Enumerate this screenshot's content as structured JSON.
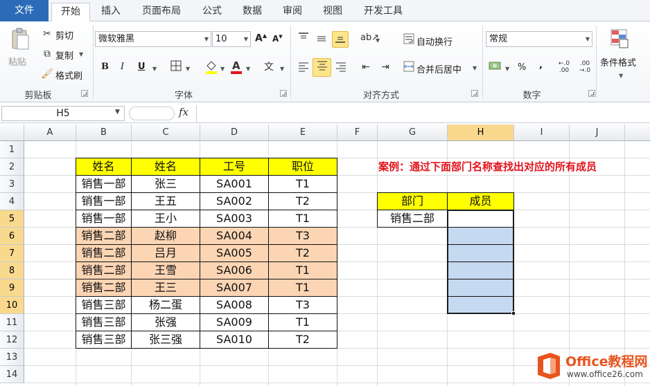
{
  "tabs": [
    "文件",
    "开始",
    "插入",
    "页面布局",
    "公式",
    "数据",
    "审阅",
    "视图",
    "开发工具"
  ],
  "ribbon": {
    "clipboard": {
      "paste": "粘贴",
      "cut": "剪切",
      "copy": "复制",
      "format_painter": "格式刷",
      "label": "剪贴板"
    },
    "font": {
      "name": "微软雅黑",
      "size": "10",
      "label": "字体"
    },
    "alignment": {
      "wrap_text": "自动换行",
      "merge_center": "合并后居中",
      "label": "对齐方式"
    },
    "number": {
      "format": "常规",
      "percent": "%",
      "comma": ",",
      "label": "数字"
    },
    "styles": {
      "conditional_format": "条件格式"
    }
  },
  "formula_bar": {
    "name_box": "H5",
    "fx": "fx",
    "content": ""
  },
  "grid": {
    "columns": [
      "A",
      "B",
      "C",
      "D",
      "E",
      "F",
      "G",
      "H",
      "I",
      "J"
    ],
    "rows": [
      "1",
      "2",
      "3",
      "4",
      "5",
      "6",
      "7",
      "8",
      "9",
      "10",
      "11",
      "12",
      "13",
      "14"
    ],
    "active_column": "H",
    "active_rows": [
      "5",
      "6",
      "7",
      "8",
      "9",
      "10"
    ]
  },
  "table": {
    "headers": [
      "姓名",
      "姓名",
      "工号",
      "职位"
    ],
    "rows": [
      [
        "销售一部",
        "张三",
        "SA001",
        "T1"
      ],
      [
        "销售一部",
        "王五",
        "SA002",
        "T2"
      ],
      [
        "销售一部",
        "王小",
        "SA003",
        "T1"
      ],
      [
        "销售二部",
        "赵柳",
        "SA004",
        "T3"
      ],
      [
        "销售二部",
        "吕月",
        "SA005",
        "T2"
      ],
      [
        "销售二部",
        "王雪",
        "SA006",
        "T1"
      ],
      [
        "销售二部",
        "王三",
        "SA007",
        "T1"
      ],
      [
        "销售三部",
        "杨二蛋",
        "SA008",
        "T3"
      ],
      [
        "销售三部",
        "张强",
        "SA009",
        "T1"
      ],
      [
        "销售三部",
        "张三强",
        "SA010",
        "T2"
      ]
    ],
    "highlight_rows": [
      3,
      4,
      5,
      6
    ],
    "header_color": "#ffff00",
    "highlight_color": "#fcd5b4"
  },
  "case_title": "案例：通过下面部门名称查找出对应的所有成员",
  "case_color": "#e3111b",
  "lookup": {
    "headers": [
      "部门",
      "成员"
    ],
    "department": "销售二部",
    "member_fill": "#c5d9f1"
  },
  "watermark": {
    "brand": "Office教程网",
    "url": "www.office26.com"
  }
}
